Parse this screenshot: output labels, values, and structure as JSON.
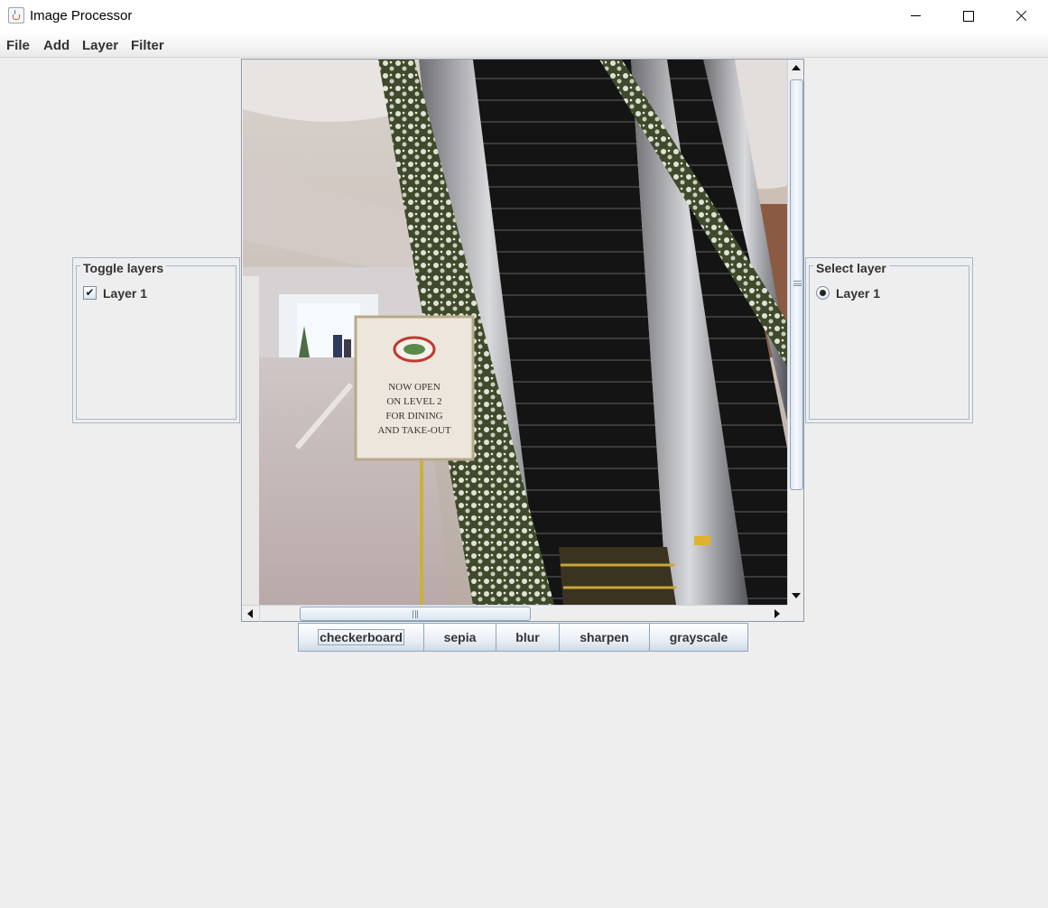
{
  "window": {
    "title": "Image Processor",
    "controls": [
      "minimize",
      "maximize",
      "close"
    ]
  },
  "menu": {
    "items": [
      {
        "label": "File"
      },
      {
        "label": "Add"
      },
      {
        "label": "Layer"
      },
      {
        "label": "Filter"
      }
    ]
  },
  "toggle_panel": {
    "title": "Toggle layers",
    "layers": [
      {
        "label": "Layer 1",
        "checked": true
      }
    ]
  },
  "select_panel": {
    "title": "Select layer",
    "layers": [
      {
        "label": "Layer 1",
        "selected": true
      }
    ]
  },
  "image": {
    "subject": "shopping mall escalator with holiday garland",
    "sign_lines": [
      "NOW OPEN",
      "ON LEVEL 2",
      "FOR DINING",
      "AND TAKE-OUT"
    ]
  },
  "filters": {
    "buttons": [
      {
        "label": "checkerboard",
        "focused": true
      },
      {
        "label": "sepia"
      },
      {
        "label": "blur"
      },
      {
        "label": "sharpen"
      },
      {
        "label": "grayscale"
      }
    ]
  },
  "colors": {
    "background": "#eeeeee",
    "border_accent": "#a3b8cc"
  }
}
